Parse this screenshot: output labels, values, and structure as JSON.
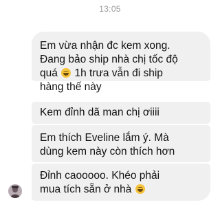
{
  "header": {
    "timestamp": "13:05"
  },
  "messages": [
    {
      "line1": "Em vừa nhận đc kem xong.",
      "line2": "Đang bảo ship nhà chị tốc độ",
      "line3_before": "quá ",
      "line3_emoji": "joy-emoji",
      "line3_after": " 1h trưa vẫn đi ship",
      "line4": "hàng thế này"
    },
    {
      "text": "Kem đỉnh dã man chị ơiiii"
    },
    {
      "line1": "Em thích Eveline lắm ý. Mà",
      "line2": "dùng kem này còn thích hơn"
    },
    {
      "line1": "Đỉnh caooooo. Khéo phải",
      "line2_before": "mua tích sẵn ở nhà ",
      "line2_emoji": "joy-emoji"
    }
  ],
  "colors": {
    "bubble_background": "#f1f0f0",
    "timestamp_text": "#9a9a9a"
  }
}
